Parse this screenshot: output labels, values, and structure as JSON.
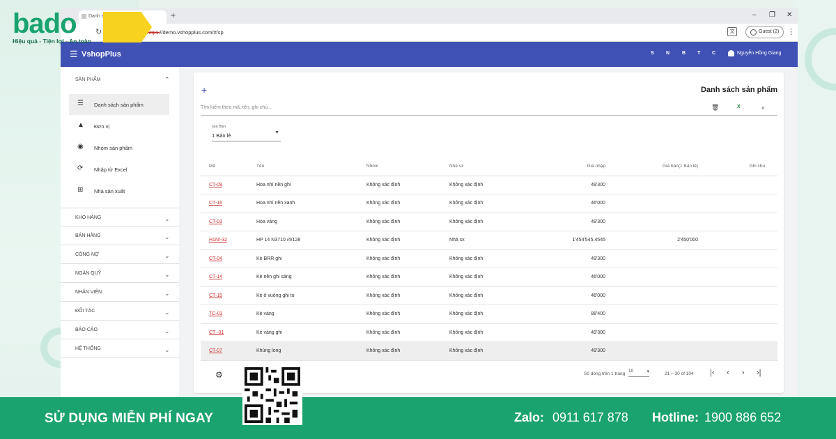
{
  "brand": {
    "logo": "bado",
    "tagline": "Hiệu quả - Tiện lợi - An toàn"
  },
  "browser": {
    "tab_title": "Danh sách sản phẩm",
    "url_scheme": "https:",
    "url_rest": "//demo.vshopplus.com/#/sp",
    "profile": "Guest (2)"
  },
  "appbar": {
    "title": "VshopPlus",
    "quick_links": [
      "S",
      "N",
      "B",
      "T",
      "C"
    ],
    "user": "Nguyễn Hồng Giang"
  },
  "sidebar": {
    "section": "SẢN PHẨM",
    "items": [
      {
        "label": "Danh sách sản phẩm",
        "icon": "list-icon",
        "active": true
      },
      {
        "label": "Đơn vị",
        "icon": "shapes-icon"
      },
      {
        "label": "Nhóm sản phẩm",
        "icon": "group-icon"
      },
      {
        "label": "Nhập từ Excel",
        "icon": "sync-icon"
      },
      {
        "label": "Nhà sản xuất",
        "icon": "factory-icon"
      }
    ],
    "groups": [
      "KHO HÀNG",
      "BÁN HÀNG",
      "CÔNG NỢ",
      "NGÂN QUỸ",
      "NHÂN VIÊN",
      "ĐỐI TÁC",
      "BÁO CÁO",
      "HỆ THỐNG"
    ]
  },
  "main": {
    "title": "Danh sách sản phẩm",
    "search_placeholder": "Tìm kiếm theo mã, tên, ghi chú...",
    "price_label": "Giá Bán",
    "price_value": "1 Bán lẻ",
    "columns": [
      "Mã",
      "Tên",
      "Nhóm",
      "Nhà sx",
      "Giá nhập",
      "Giá bán(1 Bán lẻ)",
      "Ghi chú"
    ],
    "rows": [
      [
        "CT-09",
        "Hoa nhí nền ghi",
        "Không xác định",
        "Không xác định",
        "49'300",
        "",
        ""
      ],
      [
        "CT-16",
        "Hoa nhí nền xanh",
        "Không xác định",
        "Không xác định",
        "46'000",
        "",
        ""
      ],
      [
        "CT-03",
        "Hoa vàng",
        "Không xác định",
        "Không xác định",
        "49'300",
        "",
        ""
      ],
      [
        "H1N/-32",
        "HP 14 N3710 /4/128",
        "Không xác định",
        "Nhà sx",
        "1'454'545.4545",
        "2'450'000",
        ""
      ],
      [
        "CT-04",
        "Kẻ BRR ghi",
        "Không xác định",
        "Không xác định",
        "49'300",
        "",
        ""
      ],
      [
        "CT-14",
        "Kẻ nền ghi sáng",
        "Không xác định",
        "Không xác định",
        "46'000",
        "",
        ""
      ],
      [
        "CT-15",
        "Kẻ ô vuông ghi to",
        "Không xác định",
        "Không xác định",
        "46'000",
        "",
        ""
      ],
      [
        "TC-03",
        "Kẻ vàng",
        "Không xác định",
        "Không xác định",
        "88'400",
        "",
        ""
      ],
      [
        "CT -01",
        "Kẻ vàng ghi",
        "Không xác định",
        "Không xác định",
        "49'300",
        "",
        ""
      ],
      [
        "CT-07",
        "Khủng long",
        "Không xác định",
        "Không xác định",
        "49'300",
        "",
        ""
      ]
    ],
    "rows_per_page_label": "Số dòng trên 1 trang",
    "rows_per_page": "10",
    "range": "21 – 30 of 104"
  },
  "banner": {
    "cta": "SỬ DỤNG MIỄN PHÍ NGAY",
    "zalo_label": "Zalo:",
    "zalo_value": "0911 617 878",
    "hotline_label": "Hotline:",
    "hotline_value": "1900 886 652"
  },
  "colors": {
    "primary": "#3f51b5",
    "brand_green": "#1aa36f",
    "link_red": "#d32f2f",
    "brand_yellow": "#f7d21e"
  }
}
